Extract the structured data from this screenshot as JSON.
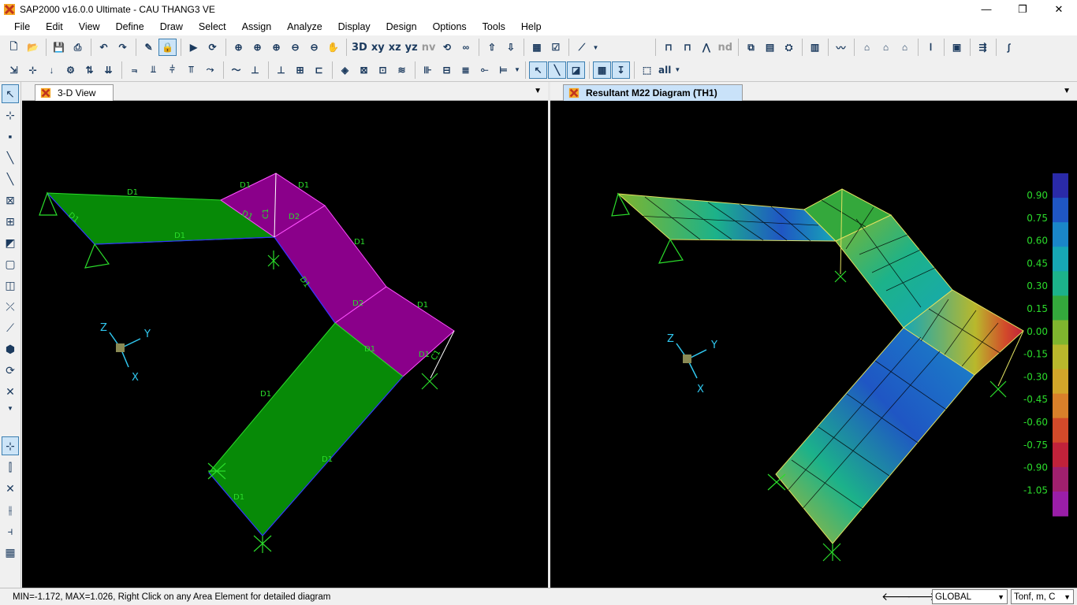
{
  "window": {
    "title": "SAP2000 v16.0.0 Ultimate  - CAU THANG3 VE",
    "minimize": "—",
    "maximize": "❐",
    "close": "✕"
  },
  "menu": [
    "File",
    "Edit",
    "View",
    "Define",
    "Draw",
    "Select",
    "Assign",
    "Analyze",
    "Display",
    "Design",
    "Options",
    "Tools",
    "Help"
  ],
  "toolbar": {
    "view_xy": "xy",
    "view_xz": "xz",
    "view_yz": "yz",
    "view_nv": "nv",
    "view_3d": "3D",
    "nd_label": "nd",
    "select_all": "all"
  },
  "panes": {
    "left": {
      "tab": "3-D View"
    },
    "right": {
      "tab": "Resultant M22 Diagram   (TH1)"
    }
  },
  "model": {
    "labels": {
      "d1": "D1",
      "d2": "D2",
      "c1": "C1"
    },
    "axes": {
      "x": "X",
      "y": "Y",
      "z": "Z"
    }
  },
  "legend": {
    "ticks": [
      "0.90",
      "0.75",
      "0.60",
      "0.45",
      "0.30",
      "0.15",
      "0.00",
      "-0.15",
      "-0.30",
      "-0.45",
      "-0.60",
      "-0.75",
      "-0.90",
      "-1.05"
    ],
    "colors": [
      "#2a2aa8",
      "#1f56c4",
      "#1a86c8",
      "#17a7b5",
      "#1cb28a",
      "#34a83c",
      "#7fb52e",
      "#b9b82c",
      "#d2a62a",
      "#d9802a",
      "#d24a2a",
      "#c0223a",
      "#a0206e",
      "#9a1ea8"
    ]
  },
  "status": {
    "message": "MIN=-1.172, MAX=1.026, Right Click on any Area Element for detailed diagram",
    "coord_system": "GLOBAL",
    "units": "Tonf, m, C"
  }
}
